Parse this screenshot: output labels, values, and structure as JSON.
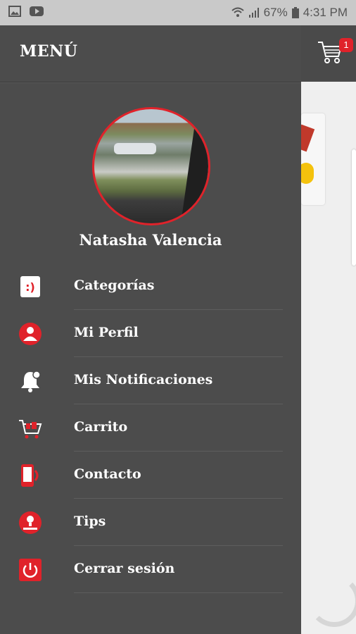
{
  "status_bar": {
    "left_icons": [
      "image-icon",
      "youtube-icon"
    ],
    "wifi_icon": "wifi-icon",
    "signal_icon": "signal-icon",
    "battery_text": "67%",
    "battery_icon": "battery-icon",
    "time": "4:31 PM"
  },
  "background_app": {
    "cart_badge": "1"
  },
  "drawer": {
    "title": "MENÚ",
    "user_name": "Natasha Valencia",
    "items": [
      {
        "label": "Categorías",
        "icon": "smile-card-icon"
      },
      {
        "label": "Mi Perfil",
        "icon": "user-icon"
      },
      {
        "label": "Mis Notificaciones",
        "icon": "bell-icon"
      },
      {
        "label": "Carrito",
        "icon": "cart-icon"
      },
      {
        "label": "Contacto",
        "icon": "phone-icon"
      },
      {
        "label": "Tips",
        "icon": "tip-icon"
      },
      {
        "label": "Cerrar sesión",
        "icon": "power-icon"
      }
    ]
  },
  "colors": {
    "accent": "#e0222a",
    "drawer_bg": "#4c4c4c",
    "text": "#ffffff"
  }
}
